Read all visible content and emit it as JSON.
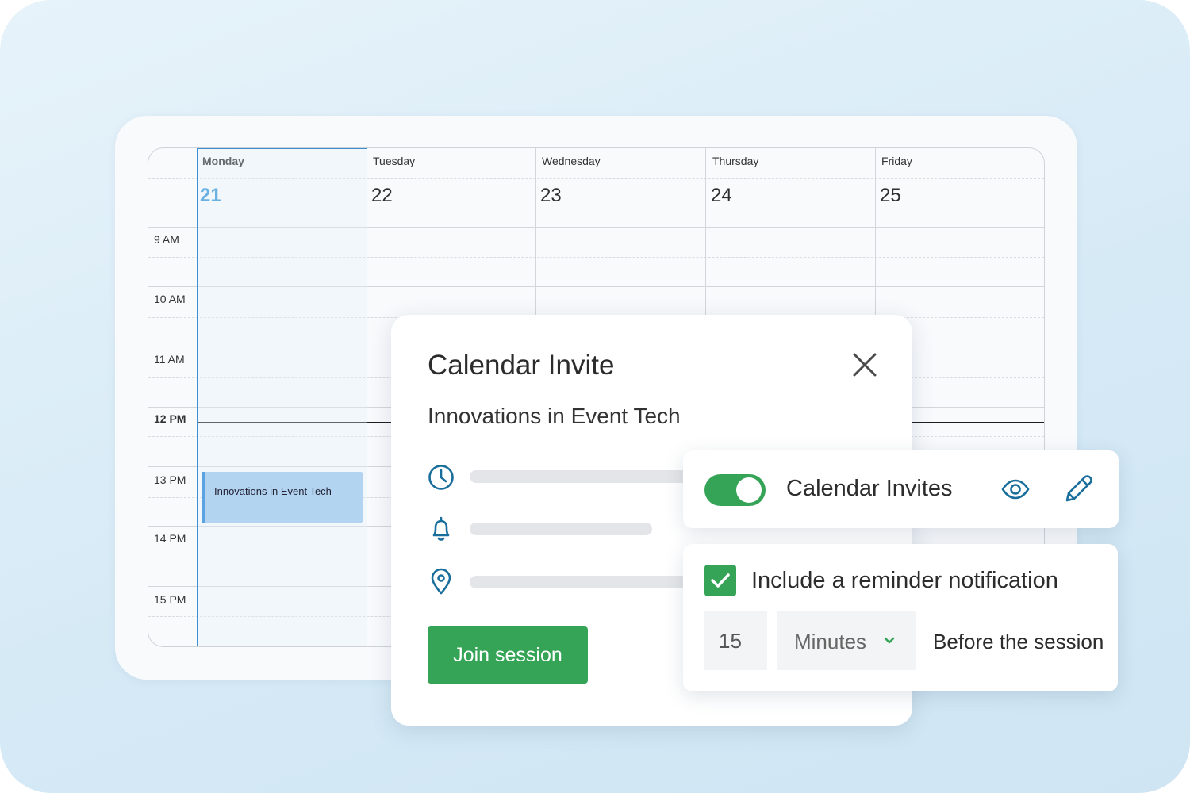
{
  "calendar": {
    "days": [
      {
        "name": "Monday",
        "date": "21",
        "active": true
      },
      {
        "name": "Tuesday",
        "date": "22"
      },
      {
        "name": "Wednesday",
        "date": "23"
      },
      {
        "name": "Thursday",
        "date": "24"
      },
      {
        "name": "Friday",
        "date": "25"
      }
    ],
    "times": [
      "9 AM",
      "10 AM",
      "11 AM",
      "12 PM",
      "13 PM",
      "14 PM",
      "15 PM"
    ],
    "current_time": "12 PM",
    "event": {
      "title": "Innovations in Event Tech"
    }
  },
  "invite": {
    "title": "Calendar Invite",
    "session_name": "Innovations in Event Tech",
    "join_label": "Join session",
    "icons": [
      "clock-icon",
      "bell-icon",
      "location-pin-icon",
      "close-icon"
    ]
  },
  "invites_setting": {
    "label": "Calendar Invites",
    "enabled": true,
    "icons": [
      "eye-icon",
      "pencil-icon"
    ]
  },
  "reminder": {
    "label": "Include a reminder notification",
    "checked": true,
    "amount": "15",
    "unit": "Minutes",
    "suffix": "Before the session"
  },
  "colors": {
    "accent_blue": "#2a8fd6",
    "icon_blue": "#1a6e9c",
    "green": "#35a457",
    "event_fill": "#b3d4f1"
  }
}
